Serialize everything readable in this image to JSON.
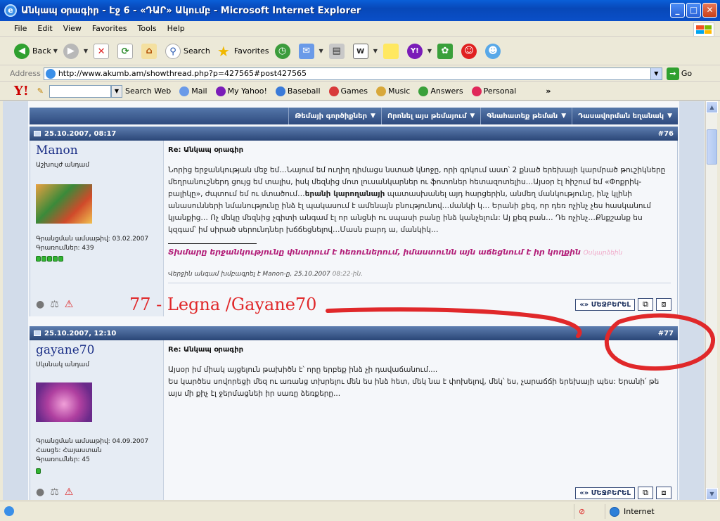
{
  "window": {
    "title": "Անկապ օրագիր - Էջ 6 - «ԴԱՐ» Ակումբ - Microsoft Internet Explorer",
    "minimize": "_",
    "maximize": "□",
    "close": "✕"
  },
  "menu": [
    "File",
    "Edit",
    "View",
    "Favorites",
    "Tools",
    "Help"
  ],
  "toolbar": {
    "back": "Back",
    "search": "Search",
    "favorites": "Favorites"
  },
  "address": {
    "label": "Address",
    "url": "http://www.akumb.am/showthread.php?p=427565#post427565",
    "go": "Go"
  },
  "yahoo_bar": {
    "logo": "Y!",
    "search_web": "Search Web",
    "items": [
      "Mail",
      "My Yahoo!",
      "Baseball",
      "Games",
      "Music",
      "Answers",
      "Personal"
    ],
    "more": "»"
  },
  "thread_tools": [
    "Թեմայի գործիքներ",
    "Որոնել այս թեմայում",
    "Գնահատեք թեման",
    "Դասավորման եղանակ"
  ],
  "posts": [
    {
      "date": "25.10.2007, 08:17",
      "number": "#76",
      "username": "Manon",
      "user_title": "Աշխույժ անդամ",
      "join_date": "Գրանցման ամսաթիվ: 03.02.2007",
      "posts_count": "Գրառումներ: 439",
      "reputation": 5,
      "title": "Re: Անկապ օրագիր",
      "text_before": "Նորից երջանկության մեջ եմ…Նայում եմ ուղիղ դիմացս նստած կնոջը, որի գրկում աստ՝ 2 քնած երեխայի կարմրած թուշիկները մեղրանուշներդ ցույց եմ տալիս, իսկ մեզնից մոտ լուսանկարներ ու ֆոտոներ հետազոտելիս…Այսօր էլ հիշում եմ «Փոքրիկ-բալիկը», ժպտում եմ ու մտածում…",
      "text_bold": "երանի կարողանայի",
      "text_after": " պատասխանել այդ հարցերին, անմեղ մանկությունը, ինչ կլինի անասունների նմանությունը ինձ էլ պակասում է ամենայն բնությունով…մանկի կ… Երանի քեզ, որ դեռ ոչինչ չես հասկանում կյանքից… Ոչ մեկը մեզնից չգիտի անգամ էլ որ անցնի ու սպասի բանը ինձ կանչելուն: Այ քեզ բան… Դե ոչինչ…Քնքշանք ես կզգամ՝ իմ սիրած սերունդներ խճճեցնելով…Մասն բարդ ա, մանկիկ…",
      "signature": "Տխմարը երջանկությունը փնտրում է հեռուներում, իմաստունն այն աճեցնում է իր կողքին",
      "signature_light": "Օսկարձեին",
      "edited": "Վերջին անգամ խմբագրել է Manon-ը, 25.10.2007",
      "edited_time": "08:22-ին."
    },
    {
      "date": "25.10.2007, 12:10",
      "number": "#77",
      "username": "gayane70",
      "user_title": "Սկսնակ անդամ",
      "join_date": "Գրանցման ամսաթիվ: 04.09.2007",
      "location": "Հասցե: Հայաստան",
      "posts_count": "Գրառումներ: 45",
      "reputation": 1,
      "title": "Re: Անկապ օրագիր",
      "text": "Այսօր իմ միակ այցելուն թախիծն է՝ որը երբեք ինձ չի դավաճանում....\nԵս կարծես սովորեցի մեզ ու առանց տխրելու մեն ես ինձ հետ, մեկ նա է փոխելով, մեկ՝ ես, չարաճճի երեխայի պես: Երանի՛ թե այս մի քիչ էլ ջերմացնեի իր սառը ձեռքերը..."
    }
  ],
  "quote_button": "«» ՄԵՋԲԵՐԵԼ",
  "annotation": "77 - Legna /Gayane70",
  "status": {
    "zone": "Internet"
  },
  "colors": {
    "annotation_red": "#E0282A",
    "post_header": "#2A4677",
    "username": "#1A2E86",
    "signature": "#B21E78"
  }
}
